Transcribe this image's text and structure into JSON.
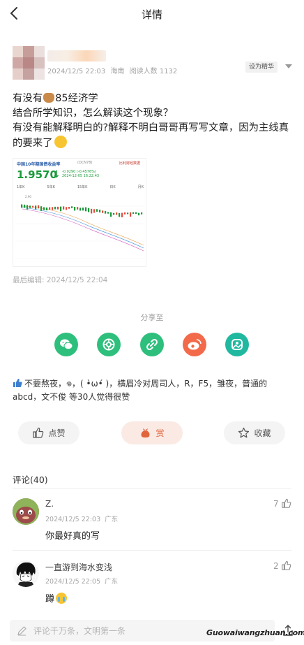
{
  "header": {
    "title": "详情"
  },
  "post": {
    "meta": {
      "timestamp": "2024/12/5 22:03",
      "location": "海南",
      "read_count": "阅读人数 1132"
    },
    "set_featured_label": "设为精华",
    "text_lines": [
      {
        "before": "有没有",
        "after": "85经济学"
      },
      "结合所学知识，怎么解读这个现象？",
      "有没有能解释明白的?解释不明白哥哥再写写文章，因为主线真的要来了"
    ],
    "edited": "最后编辑: 2024/12/5 22:04",
    "chart_image": {
      "title": "中国10年期国债收益率",
      "code": "(DCN78)",
      "brand": "比利财经数据",
      "price": "1.9570",
      "change": "-0.0290 (-0.4576%)",
      "time": "2024-12-05 16:22:43",
      "tabs": [
        "1年K",
        "",
        "5年K",
        "",
        "15年K",
        "",
        "日K",
        "",
        "月K"
      ],
      "y_top_label": "2.90"
    }
  },
  "share": {
    "label": "分享至",
    "buttons": [
      {
        "name": "wechat",
        "color": "#2ebf7d"
      },
      {
        "name": "moments",
        "color": "#2ebf7d"
      },
      {
        "name": "link",
        "color": "#2ebf7d"
      },
      {
        "name": "weibo",
        "color": "#f36a4b"
      },
      {
        "name": "qzone",
        "color": "#21b8a0"
      }
    ]
  },
  "likers": {
    "text": "不要熬夜，𖦹，( •̀ω•́ )，横眉冷对周司人，R，F5，雏夜，普通的abcd，文不俊 等30人觉得很赞"
  },
  "actions": {
    "like": "点赞",
    "reward": "赏",
    "favorite": "收藏"
  },
  "comments": {
    "header": "评论(40)",
    "items": [
      {
        "name": "Z.",
        "time": "2024/12/5 22:03",
        "region": "广东",
        "body": "你最好真的写",
        "likes": "7"
      },
      {
        "name": "一直游到海水变浅",
        "time": "2024/12/5 22:05",
        "region": "广东",
        "body": "蹲",
        "likes": "2"
      }
    ]
  },
  "comment_bar": {
    "placeholder": "评论千万条，文明第一条"
  },
  "watermark": "Guowaiwangzhuan.com"
}
